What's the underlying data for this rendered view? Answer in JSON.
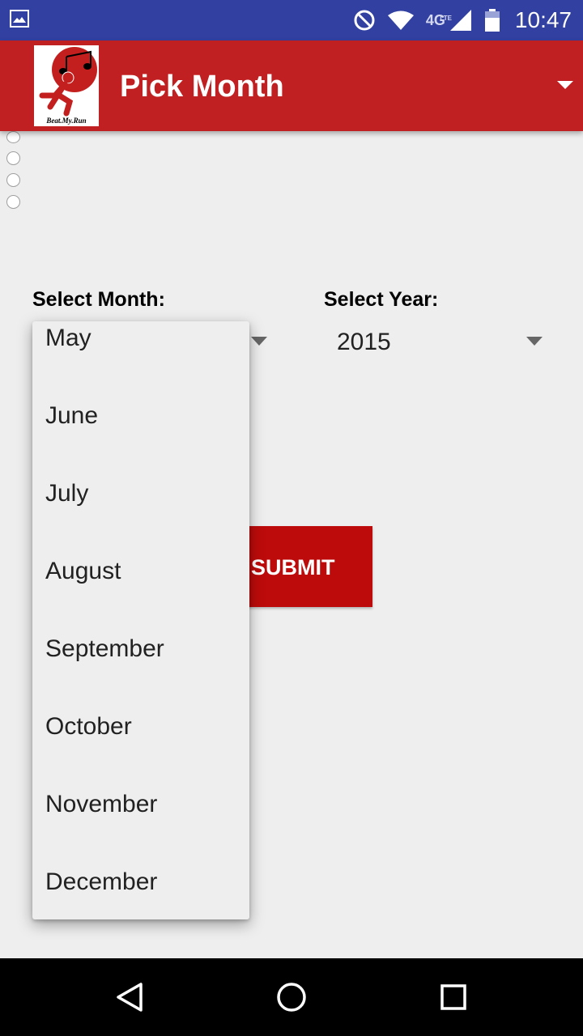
{
  "status_bar": {
    "network": "4G",
    "network_sub": "LTE",
    "time": "10:47"
  },
  "app_bar": {
    "title": "Pick Month",
    "logo_text": "Beat.My.Run"
  },
  "form": {
    "month_label": "Select Month:",
    "year_label": "Select Year:",
    "year_value": "2015",
    "submit_label": "SUBMIT"
  },
  "month_dropdown": {
    "items": [
      "May",
      "June",
      "July",
      "August",
      "September",
      "October",
      "November",
      "December"
    ]
  },
  "colors": {
    "status_bar": "#3140a1",
    "app_bar": "#c02021",
    "submit": "#bd0b0b"
  }
}
